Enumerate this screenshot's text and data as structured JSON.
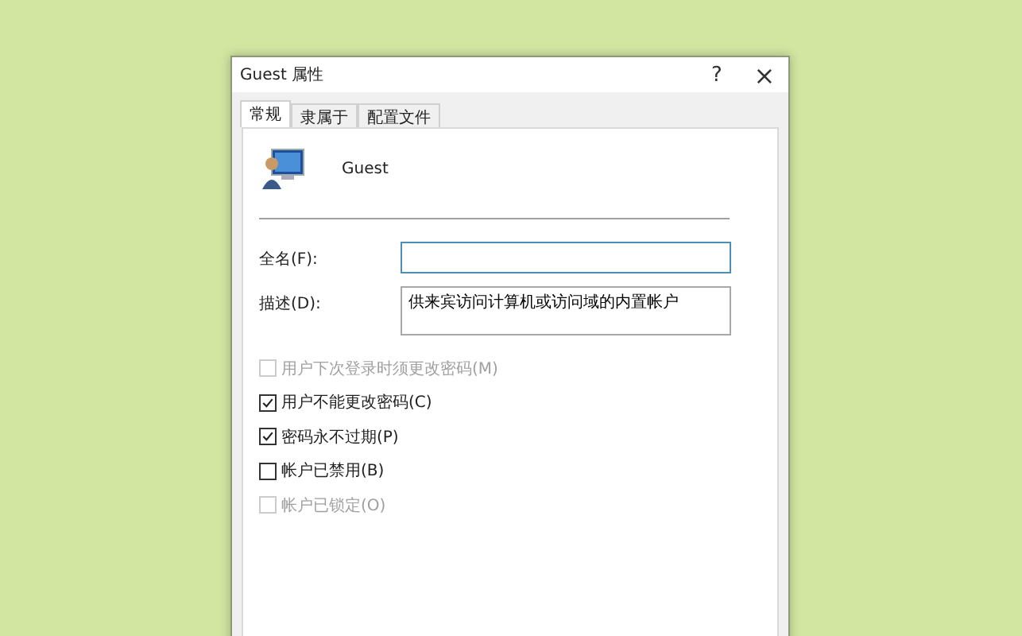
{
  "window": {
    "title": "Guest 属性",
    "help": "?",
    "close": "×"
  },
  "tabs": [
    {
      "label": "常规",
      "selected": true
    },
    {
      "label": "隶属于",
      "selected": false
    },
    {
      "label": "配置文件",
      "selected": false
    }
  ],
  "user": {
    "name": "Guest"
  },
  "fields": [
    {
      "label": "全名(F):",
      "focused": true,
      "kind": "line"
    },
    {
      "label": "描述(D):",
      "value": "供来宾访问计算机或访问域的内置帐户",
      "focused": false,
      "kind": "box"
    }
  ],
  "checkboxes": [
    {
      "label": "用户下次登录时须更改密码(M)",
      "checked": false,
      "disabled": true
    },
    {
      "label": "用户不能更改密码(C)",
      "checked": true,
      "disabled": false
    },
    {
      "label": "密码永不过期(P)",
      "checked": true,
      "disabled": false
    },
    {
      "label": "帐户已禁用(B)",
      "checked": false,
      "disabled": false
    },
    {
      "label": "帐户已锁定(O)",
      "checked": false,
      "disabled": true
    }
  ]
}
